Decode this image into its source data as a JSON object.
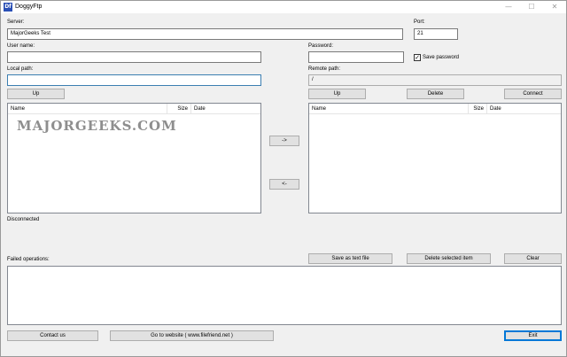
{
  "window": {
    "title": "DoggyFtp",
    "app_icon": "Df",
    "minimize_glyph": "—",
    "maximize_glyph": "☐",
    "close_glyph": "✕"
  },
  "connection": {
    "server_label": "Server:",
    "server_value": "MajorGeeks Test",
    "port_label": "Port:",
    "port_value": "21",
    "username_label": "User name:",
    "username_value": "",
    "password_label": "Password:",
    "password_value": "",
    "save_password_label": "Save password",
    "save_password_checked": true,
    "check_glyph": "✓",
    "local_path_label": "Local path:",
    "local_path_value": "",
    "remote_path_label": "Remote path:",
    "remote_path_value": "/"
  },
  "local": {
    "up_button": "Up",
    "columns": [
      "Name",
      "Size",
      "Date"
    ]
  },
  "transfer": {
    "upload_button": "->",
    "download_button": "<-"
  },
  "remote": {
    "up_button": "Up",
    "delete_button": "Delete",
    "connect_button": "Connect",
    "columns": [
      "Name",
      "Size",
      "Date"
    ]
  },
  "status": {
    "text": "Disconnected"
  },
  "failed": {
    "label": "Failed operations:",
    "save_button": "Save as text file",
    "delete_selected_button": "Delete selected item",
    "clear_button": "Clear"
  },
  "footer": {
    "contact_button": "Contact us",
    "website_button": "Go to website ( www.filefriend.net )",
    "exit_button": "Exit"
  },
  "watermark": "MAJORGEEKS.COM"
}
